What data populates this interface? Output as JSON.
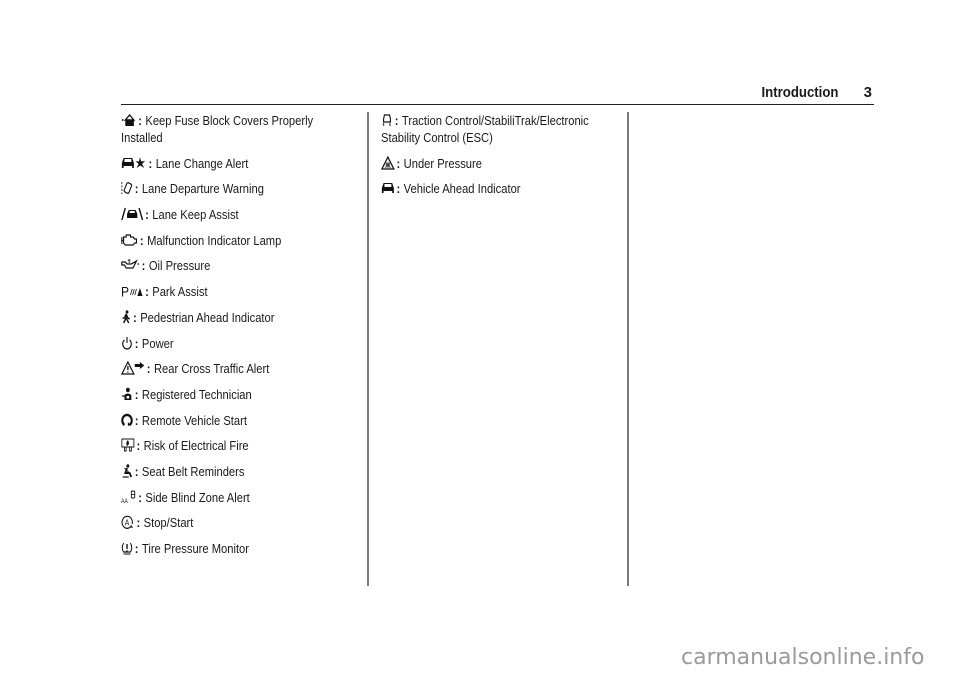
{
  "header": {
    "title": "Introduction",
    "page_number": "3"
  },
  "separator": ":",
  "columns": {
    "left": [
      {
        "icon": "fuse-block-cover-icon",
        "label": "Keep Fuse Block Covers Properly Installed"
      },
      {
        "icon": "lane-change-alert-icon",
        "label": "Lane Change Alert"
      },
      {
        "icon": "lane-departure-warning-icon",
        "label": "Lane Departure Warning"
      },
      {
        "icon": "lane-keep-assist-icon",
        "label": "Lane Keep Assist"
      },
      {
        "icon": "engine-malfunction-icon",
        "label": "Malfunction Indicator Lamp"
      },
      {
        "icon": "oil-can-icon",
        "label": "Oil Pressure"
      },
      {
        "icon": "park-assist-icon",
        "label": "Park Assist"
      },
      {
        "icon": "pedestrian-icon",
        "label": "Pedestrian Ahead Indicator"
      },
      {
        "icon": "power-icon",
        "label": "Power"
      },
      {
        "icon": "rear-cross-traffic-icon",
        "label": "Rear Cross Traffic Alert"
      },
      {
        "icon": "technician-icon",
        "label": "Registered Technician"
      },
      {
        "icon": "remote-start-icon",
        "label": "Remote Vehicle Start"
      },
      {
        "icon": "electrical-fire-icon",
        "label": "Risk of Electrical Fire"
      },
      {
        "icon": "seat-belt-icon",
        "label": "Seat Belt Reminders"
      },
      {
        "icon": "side-blind-zone-icon",
        "label": "Side Blind Zone Alert"
      },
      {
        "icon": "stop-start-icon",
        "label": "Stop/Start"
      },
      {
        "icon": "tire-pressure-icon",
        "label": "Tire Pressure Monitor"
      }
    ],
    "middle": [
      {
        "icon": "traction-control-icon",
        "label": "Traction Control/StabiliTrak/Electronic Stability Control (ESC)"
      },
      {
        "icon": "under-pressure-icon",
        "label": "Under Pressure"
      },
      {
        "icon": "vehicle-ahead-icon",
        "label": "Vehicle Ahead Indicator"
      }
    ]
  },
  "watermark": "carmanualsonline.info"
}
